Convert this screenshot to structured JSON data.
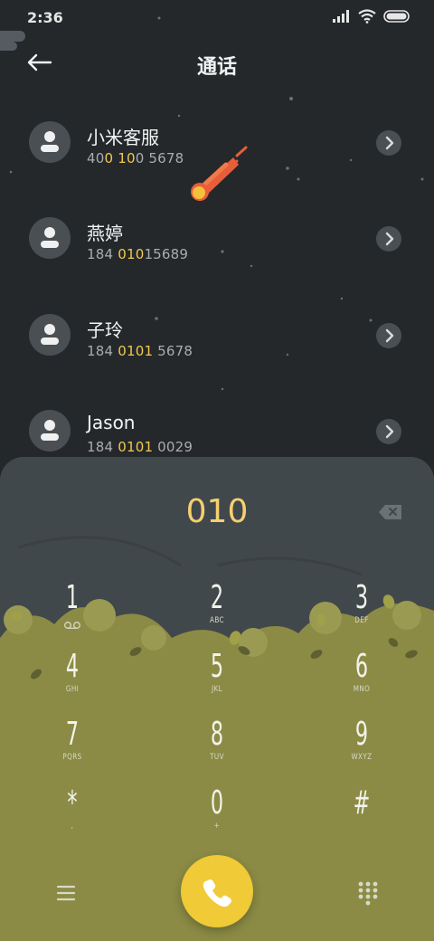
{
  "status_bar": {
    "time": "2:36"
  },
  "header": {
    "title": "通话"
  },
  "contacts": [
    {
      "name": "小米客服",
      "number_parts": [
        "40",
        "0",
        " ",
        "10",
        "0 5678"
      ]
    },
    {
      "name": "燕婷",
      "number_parts": [
        "184 ",
        "010",
        "",
        "",
        "15689"
      ]
    },
    {
      "name": "子玲",
      "number_parts": [
        "184 ",
        "010",
        "1",
        "",
        " 5678"
      ]
    },
    {
      "name": "Jason",
      "number_parts": [
        "184 ",
        "010",
        "1",
        "",
        " 0029"
      ]
    }
  ],
  "dialer": {
    "input": "010",
    "keys": [
      {
        "digit": "1",
        "letters": ""
      },
      {
        "digit": "2",
        "letters": "ABC"
      },
      {
        "digit": "3",
        "letters": "DEF"
      },
      {
        "digit": "4",
        "letters": "GHI"
      },
      {
        "digit": "5",
        "letters": "JKL"
      },
      {
        "digit": "6",
        "letters": "MNO"
      },
      {
        "digit": "7",
        "letters": "PQRS"
      },
      {
        "digit": "8",
        "letters": "TUV"
      },
      {
        "digit": "9",
        "letters": "WXYZ"
      },
      {
        "digit": "*",
        "letters": ","
      },
      {
        "digit": "0",
        "letters": "+"
      },
      {
        "digit": "#",
        "letters": ""
      }
    ]
  },
  "colors": {
    "background": "#24282b",
    "highlight": "#f2c94c",
    "call_button": "#f0ca37",
    "dialer_panel": "#41484c",
    "foliage": "#8b8b45"
  }
}
